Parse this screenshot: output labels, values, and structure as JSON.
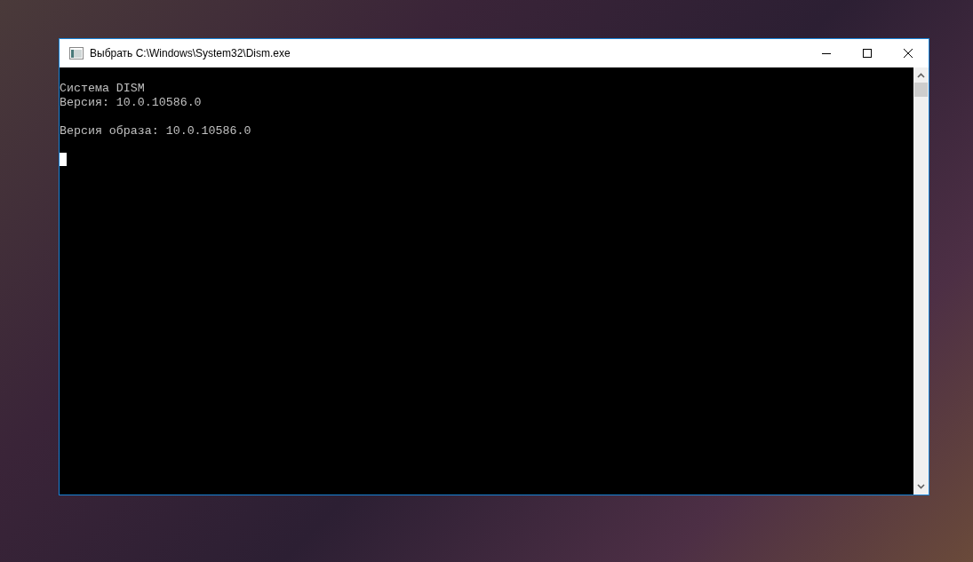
{
  "window": {
    "title": "Выбрать C:\\Windows\\System32\\Dism.exe"
  },
  "console": {
    "paragraphs": [
      [
        "Система DISM",
        "Версия: 10.0.10586.0"
      ],
      [
        "Версия образа: 10.0.10586.0"
      ]
    ]
  }
}
